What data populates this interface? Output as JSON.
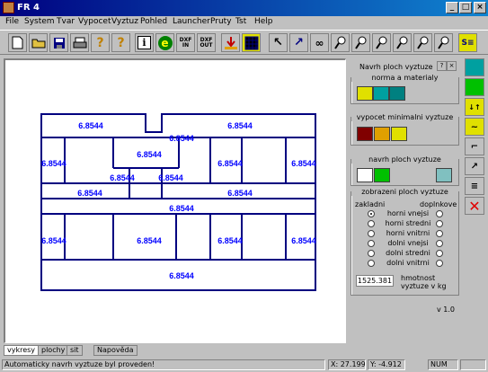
{
  "window": {
    "title": "FR 4"
  },
  "menu": [
    "File",
    "System",
    "Tvar",
    "Vypocet",
    "Vyztuz",
    "Pohled",
    "Launcher",
    "Pruty",
    "Tst",
    "Help"
  ],
  "menu_underline": [
    "F",
    "S",
    "T",
    "V",
    "z",
    "P",
    "L",
    "r",
    "s",
    "H"
  ],
  "toolbar": {
    "buttons": [
      {
        "name": "new-file-icon",
        "glyph": ""
      },
      {
        "name": "open-folder-icon",
        "glyph": ""
      },
      {
        "name": "save-disk-icon",
        "glyph": ""
      },
      {
        "name": "print-icon",
        "glyph": ""
      },
      {
        "name": "help-question-icon",
        "glyph": "?"
      },
      {
        "name": "context-help-icon",
        "glyph": "?"
      },
      {
        "name": "info-icon",
        "glyph": "i"
      },
      {
        "name": "browser-e-icon",
        "glyph": "e"
      },
      {
        "name": "dxf-in-button",
        "glyph": "DXF IN"
      },
      {
        "name": "dxf-out-button",
        "glyph": "DXF OUT"
      },
      {
        "name": "load-icon",
        "glyph": ""
      },
      {
        "name": "grid-icon",
        "glyph": ""
      },
      {
        "name": "select-cursor-icon",
        "glyph": "↖"
      },
      {
        "name": "arrow-icon",
        "glyph": "↗"
      },
      {
        "name": "glasses-icon",
        "glyph": "∞"
      },
      {
        "name": "zoom-icon",
        "glyph": "⚲"
      },
      {
        "name": "zoom-in-icon",
        "glyph": "⚲"
      },
      {
        "name": "zoom-out-icon",
        "glyph": "⚲"
      },
      {
        "name": "zoom-window-icon",
        "glyph": "⚲"
      },
      {
        "name": "zoom-all-icon",
        "glyph": "⚲"
      },
      {
        "name": "zoom-previous-icon",
        "glyph": "⚲"
      },
      {
        "name": "s-icon",
        "glyph": "S"
      }
    ]
  },
  "panel": {
    "title": "Navrh ploch vyztuze",
    "help_btn": "?",
    "close_btn": "×",
    "group1": "norma a materialy",
    "group2": "vypocet minimalni vyztuze",
    "group3": "navrh ploch vyztuze",
    "group4": "zobrazeni ploch vyztuze",
    "col_left": "zakladni",
    "col_right": "doplnkove",
    "options": [
      "horni vnejsi",
      "horni stredni",
      "horni vnitrni",
      "dolni vnejsi",
      "dolni stredni",
      "dolni vnitrni"
    ],
    "selected_left": 0,
    "mass_value": "1525.381",
    "mass_label_1": "hmotnost",
    "mass_label_2": "vyztuze v kg",
    "version": "v 1.0"
  },
  "canvas": {
    "value_label": "6.8544"
  },
  "tabs": [
    "vykresy",
    "plochy",
    "sit",
    "Napověda"
  ],
  "active_tab": 0,
  "status": {
    "message": "Automaticky navrh vyztuze byl proveden!",
    "x": "X: 27.199",
    "y": "Y: -4.912",
    "num": "NUM"
  },
  "colors": {
    "drawing": "#000080",
    "label": "#0000ff",
    "title_bar": "#000080"
  }
}
